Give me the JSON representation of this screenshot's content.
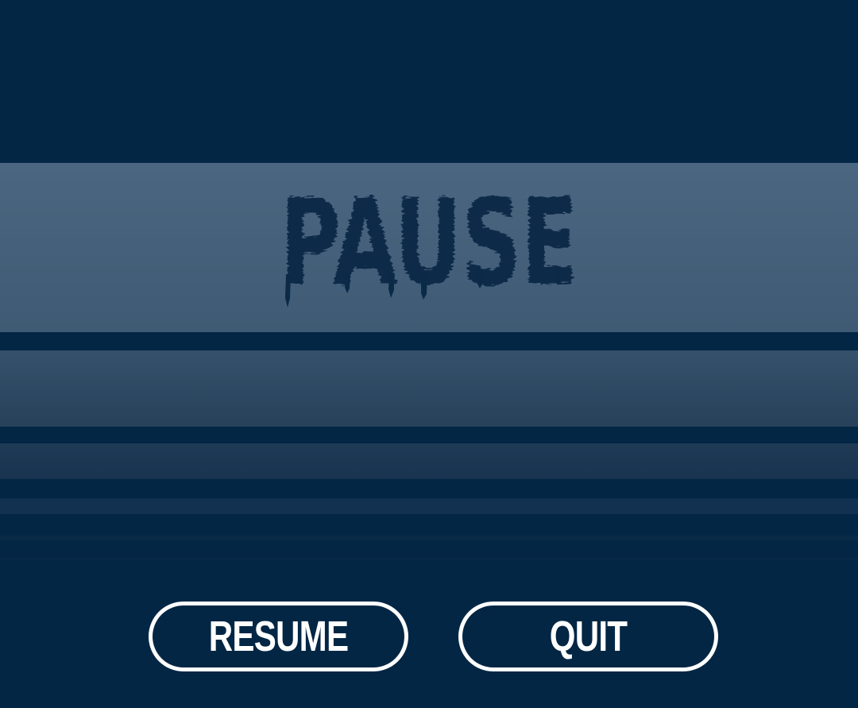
{
  "pause_menu": {
    "title": "PAUSE",
    "resume_label": "RESUME",
    "quit_label": "QUIT"
  },
  "colors": {
    "background": "#022644",
    "title_band": "#4b6680",
    "title_text": "#0a2a48",
    "button_border": "#ffffff",
    "button_text": "#ffffff"
  }
}
